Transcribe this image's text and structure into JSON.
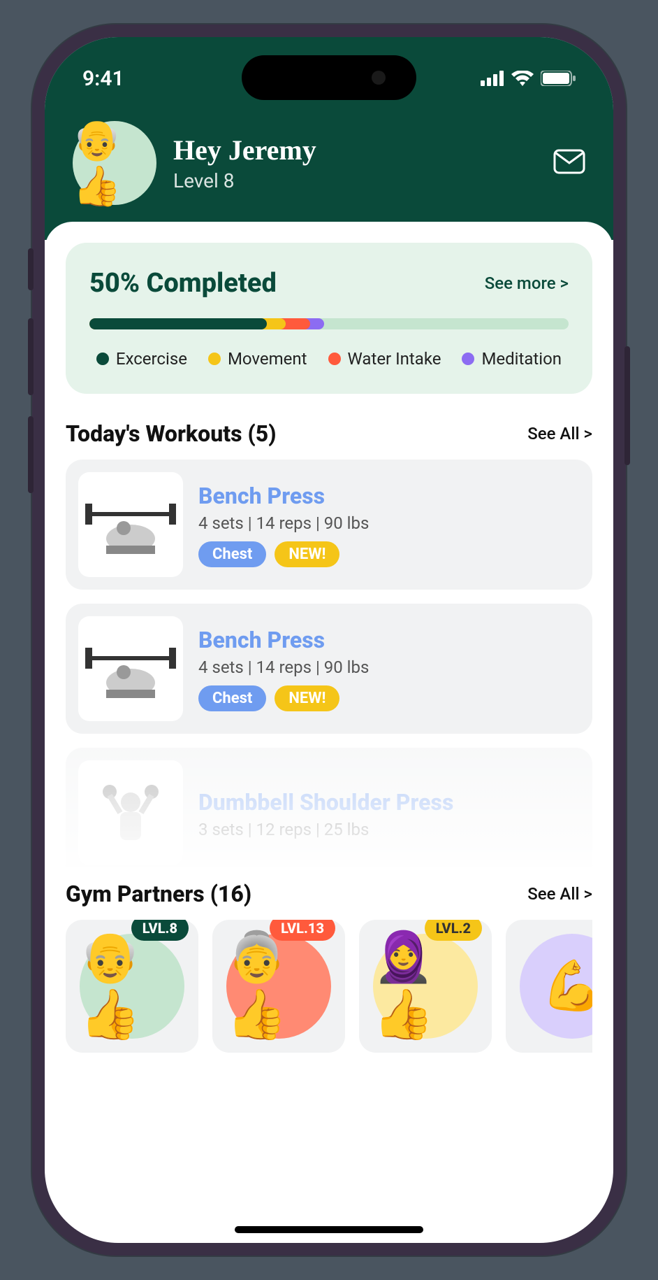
{
  "status": {
    "time": "9:41"
  },
  "header": {
    "greeting": "Hey Jeremy",
    "level": "Level 8",
    "avatar_emoji": "👴👍"
  },
  "progress": {
    "title": "50% Completed",
    "see_more": "See more >",
    "legend": {
      "exercise": "Excercise",
      "movement": "Movement",
      "water": "Water Intake",
      "meditation": "Meditation"
    }
  },
  "workouts": {
    "title": "Today's Workouts (5)",
    "see_all": "See All >",
    "items": [
      {
        "name": "Bench Press",
        "detail": "4 sets | 14 reps | 90 lbs",
        "tag1": "Chest",
        "tag2": "NEW!"
      },
      {
        "name": "Bench Press",
        "detail": "4 sets | 14 reps | 90 lbs",
        "tag1": "Chest",
        "tag2": "NEW!"
      },
      {
        "name": "Dumbbell Shoulder Press",
        "detail": "3 sets | 12 reps | 25 lbs",
        "tag1": "",
        "tag2": ""
      }
    ]
  },
  "partners": {
    "title": "Gym Partners (16)",
    "see_all": "See All >",
    "items": [
      {
        "level": "LVL.8",
        "emoji": "👴👍"
      },
      {
        "level": "LVL.13",
        "emoji": "👵👍"
      },
      {
        "level": "LVL.2",
        "emoji": "🧕👍"
      },
      {
        "level": "",
        "emoji": "💪"
      }
    ]
  },
  "chart_data": {
    "type": "bar",
    "title": "50% Completed",
    "categories": [
      "Excercise",
      "Movement",
      "Water Intake",
      "Meditation"
    ],
    "values": [
      37,
      4,
      5,
      3
    ],
    "total_percent": 50,
    "colors": [
      "#0a4a3a",
      "#f5c518",
      "#ff5a3c",
      "#8c6cf2"
    ]
  }
}
